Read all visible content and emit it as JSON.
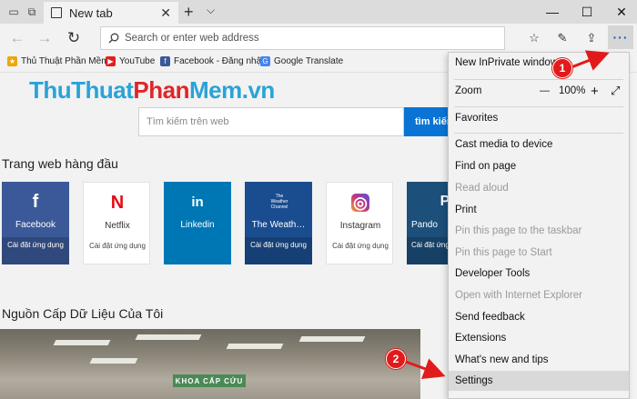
{
  "browser": {
    "tab": {
      "title": "New tab",
      "icon": "tab-page-icon"
    },
    "address_bar": {
      "placeholder": "Search or enter web address"
    }
  },
  "favorites": [
    {
      "label": "Thủ Thuật Phần Mềm",
      "icon": "bookmark-icon",
      "color": "#f0a500"
    },
    {
      "label": "YouTube",
      "icon": "youtube-icon",
      "color": "#e02020"
    },
    {
      "label": "Facebook - Đăng nhập",
      "icon": "facebook-icon",
      "color": "#3b5998"
    },
    {
      "label": "Google Translate",
      "icon": "translate-icon",
      "color": "#4285f4"
    }
  ],
  "page": {
    "logo": {
      "part1": "ThuThuat",
      "part2": "Phan",
      "part3": "Mem.vn"
    },
    "search": {
      "placeholder": "Tìm kiếm trên web",
      "button_label": "tìm kiếm"
    },
    "top_sites_title": "Trang web hàng đầu",
    "top_sites": [
      {
        "name": "Facebook",
        "logo": "f",
        "sub": "Cài đặt ứng dụng",
        "color": "#3b5998",
        "style": "dark"
      },
      {
        "name": "Netflix",
        "logo": "N",
        "sub": "Cài đặt ứng dụng",
        "color": "#e50914",
        "style": "light"
      },
      {
        "name": "Linkedin",
        "logo": "in",
        "sub": "",
        "color": "#0077b5",
        "style": "dark"
      },
      {
        "name": "The Weath…",
        "logo": "The Weather Channel",
        "sub": "Cài đặt ứng dụng",
        "color": "#1a4d8f",
        "style": "dark"
      },
      {
        "name": "Instagram",
        "logo": "◎",
        "sub": "Cài đặt ứng dụng",
        "color": "#c13584",
        "style": "light"
      },
      {
        "name": "Pando",
        "logo": "P",
        "sub": "Cài đặt ứng dụng",
        "color": "#1c4f7a",
        "style": "dark"
      }
    ],
    "feed_title": "Nguồn Cấp Dữ Liệu Của Tôi",
    "feed_sign": "KHOA CẤP CỨU"
  },
  "menu": {
    "new_inprivate": "New InPrivate window",
    "zoom_label": "Zoom",
    "zoom_minus": "—",
    "zoom_value": "100%",
    "zoom_plus": "+",
    "favorites": "Favorites",
    "cast": "Cast media to device",
    "find": "Find on page",
    "read_aloud": "Read aloud",
    "print": "Print",
    "pin_taskbar": "Pin this page to the taskbar",
    "pin_start": "Pin this page to Start",
    "dev_tools": "Developer Tools",
    "open_ie": "Open with Internet Explorer",
    "feedback": "Send feedback",
    "extensions": "Extensions",
    "whats_new": "What's new and tips",
    "settings": "Settings"
  },
  "annotations": {
    "step1": "1",
    "step2": "2",
    "color": "#e11b1b"
  }
}
